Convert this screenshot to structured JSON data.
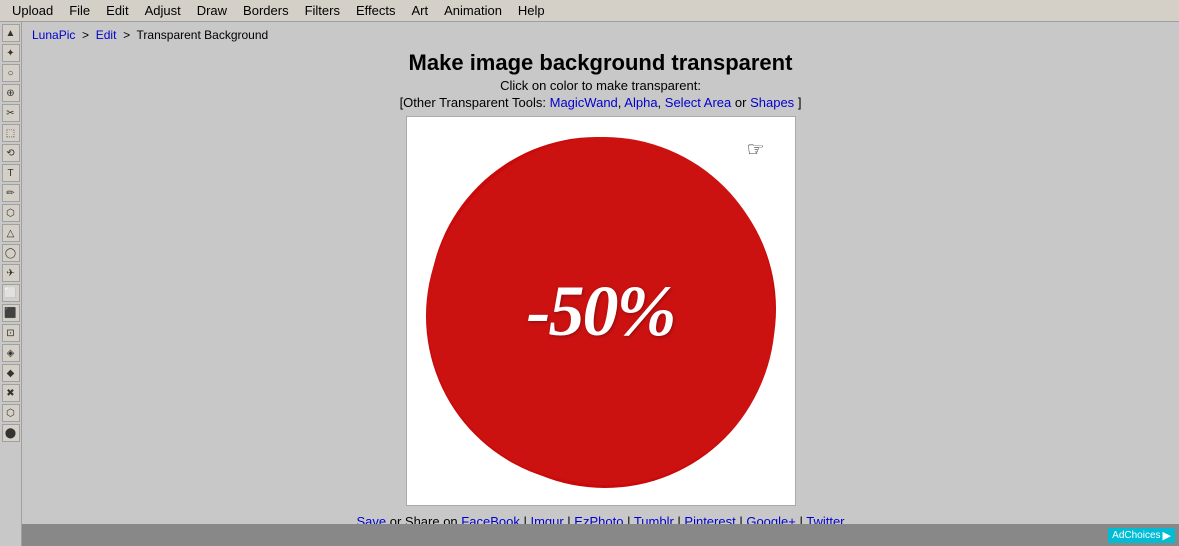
{
  "menubar": {
    "items": [
      "Upload",
      "File",
      "Edit",
      "Adjust",
      "Draw",
      "Borders",
      "Filters",
      "Effects",
      "Art",
      "Animation",
      "Help"
    ]
  },
  "breadcrumb": {
    "lunaPicLabel": "LunaPic",
    "editLabel": "Edit",
    "currentPage": "Transparent Background"
  },
  "page": {
    "title": "Make image background transparent",
    "subtitle": "Click on color to make transparent:",
    "tools_prefix": "[Other Transparent Tools: ",
    "tools_suffix": "]",
    "tool_magic": "MagicWand",
    "tool_alpha": "Alpha",
    "tool_select_area": "Select Area",
    "tool_or": "or",
    "tool_shapes": "Shapes"
  },
  "image": {
    "circle_text": "-50%"
  },
  "share": {
    "save_label": "Save",
    "or_share": "or Share on",
    "facebook": "FaceBook",
    "imgur": "Imgur",
    "ezphoto": "EzPhoto",
    "tumblr": "Tumblr",
    "pinterest": "Pinterest",
    "googleplus": "Google+",
    "twitter": "Twitter"
  },
  "ad": {
    "label": "AdChoices"
  },
  "toolbar_icons": [
    "▲",
    "✦",
    "○",
    "⊕",
    "✂",
    "⬚",
    "⟲",
    "T",
    "✏",
    "⬡",
    "△",
    "◯",
    "✈",
    "⬜",
    "⬛",
    "⊡",
    "◈",
    "◆",
    "✖",
    "⬡",
    "⬤"
  ]
}
